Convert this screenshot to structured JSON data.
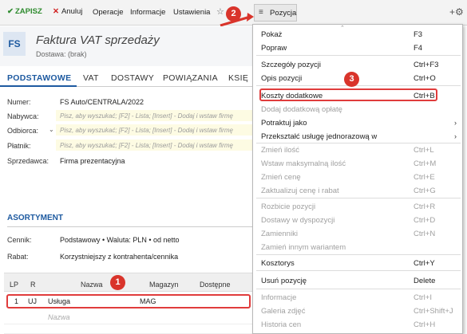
{
  "toolbar": {
    "save": "ZAPISZ",
    "cancel": "Anuluj",
    "operations": "Operacje",
    "info": "Informacje",
    "settings": "Ustawienia",
    "pozycja": "Pozycja"
  },
  "header": {
    "badge": "FS",
    "title": "Faktura VAT sprzedaży",
    "subtitle": "Dostawa: (brak)"
  },
  "tabs": [
    "PODSTAWOWE",
    "VAT",
    "DOSTAWY",
    "POWIĄZANIA",
    "KSIĘ"
  ],
  "fields": {
    "numer_label": "Numer:",
    "numer_value": "FS Auto/CENTRALA/2022",
    "nabywca_label": "Nabywca:",
    "nabywca_placeholder": "Pisz, aby wyszukać; [F2] - Lista; [Insert] - Dodaj i wstaw firmę",
    "odbiorca_label": "Odbiorca:",
    "odbiorca_placeholder": "Pisz, aby wyszukać; [F2] - Lista; [Insert] - Dodaj i wstaw firmę",
    "platnik_label": "Płatnik:",
    "platnik_placeholder": "Pisz, aby wyszukać; [F2] - Lista; [Insert] - Dodaj i wstaw firmę",
    "sprzedawca_label": "Sprzedawca:",
    "sprzedawca_value": "Firma prezentacyjna"
  },
  "asortyment": {
    "title": "ASORTYMENT",
    "cennik_label": "Cennik:",
    "cennik_value": "Podstawowy • Waluta: PLN • od netto",
    "rabat_label": "Rabat:",
    "rabat_value": "Korzystniejszy z kontrahenta/cennika"
  },
  "grid": {
    "headers": [
      "LP",
      "R",
      "Nazwa",
      "Magazyn",
      "Dostępne"
    ],
    "row": {
      "lp": "1",
      "r": "UJ",
      "nazwa": "Usługa",
      "magazyn": "MAG"
    },
    "new_row_placeholder": "Nazwa"
  },
  "menu": {
    "items": [
      {
        "label": "Pokaż",
        "shortcut": "F3"
      },
      {
        "label": "Popraw",
        "shortcut": "F4"
      },
      {
        "label": "Szczegóły pozycji",
        "shortcut": "Ctrl+F3"
      },
      {
        "label": "Opis pozycji",
        "shortcut": "Ctrl+O"
      },
      {
        "label": "Koszty dodatkowe",
        "shortcut": "Ctrl+B"
      },
      {
        "label": "Dodaj dodatkową opłatę",
        "shortcut": ""
      },
      {
        "label": "Potraktuj jako",
        "shortcut": ""
      },
      {
        "label": "Przekształć usługę jednorazową w",
        "shortcut": ""
      },
      {
        "label": "Zmień ilość",
        "shortcut": "Ctrl+L"
      },
      {
        "label": "Wstaw maksymalną ilość",
        "shortcut": "Ctrl+M"
      },
      {
        "label": "Zmień cenę",
        "shortcut": "Ctrl+E"
      },
      {
        "label": "Zaktualizuj cenę i rabat",
        "shortcut": "Ctrl+G"
      },
      {
        "label": "Rozbicie pozycji",
        "shortcut": "Ctrl+R"
      },
      {
        "label": "Dostawy w dyspozycji",
        "shortcut": "Ctrl+D"
      },
      {
        "label": "Zamienniki",
        "shortcut": "Ctrl+N"
      },
      {
        "label": "Zamień innym wariantem",
        "shortcut": ""
      },
      {
        "label": "Kosztorys",
        "shortcut": "Ctrl+Y"
      },
      {
        "label": "Usuń pozycję",
        "shortcut": "Delete"
      },
      {
        "label": "Informacje",
        "shortcut": "Ctrl+I"
      },
      {
        "label": "Galeria zdjęć",
        "shortcut": "Ctrl+Shift+J"
      },
      {
        "label": "Historia cen",
        "shortcut": "Ctrl+H"
      }
    ]
  },
  "callouts": [
    "1",
    "2",
    "3"
  ],
  "colors": {
    "accent": "#1e5aa0",
    "highlight": "#e03c3c",
    "save": "#2e8b2e"
  }
}
